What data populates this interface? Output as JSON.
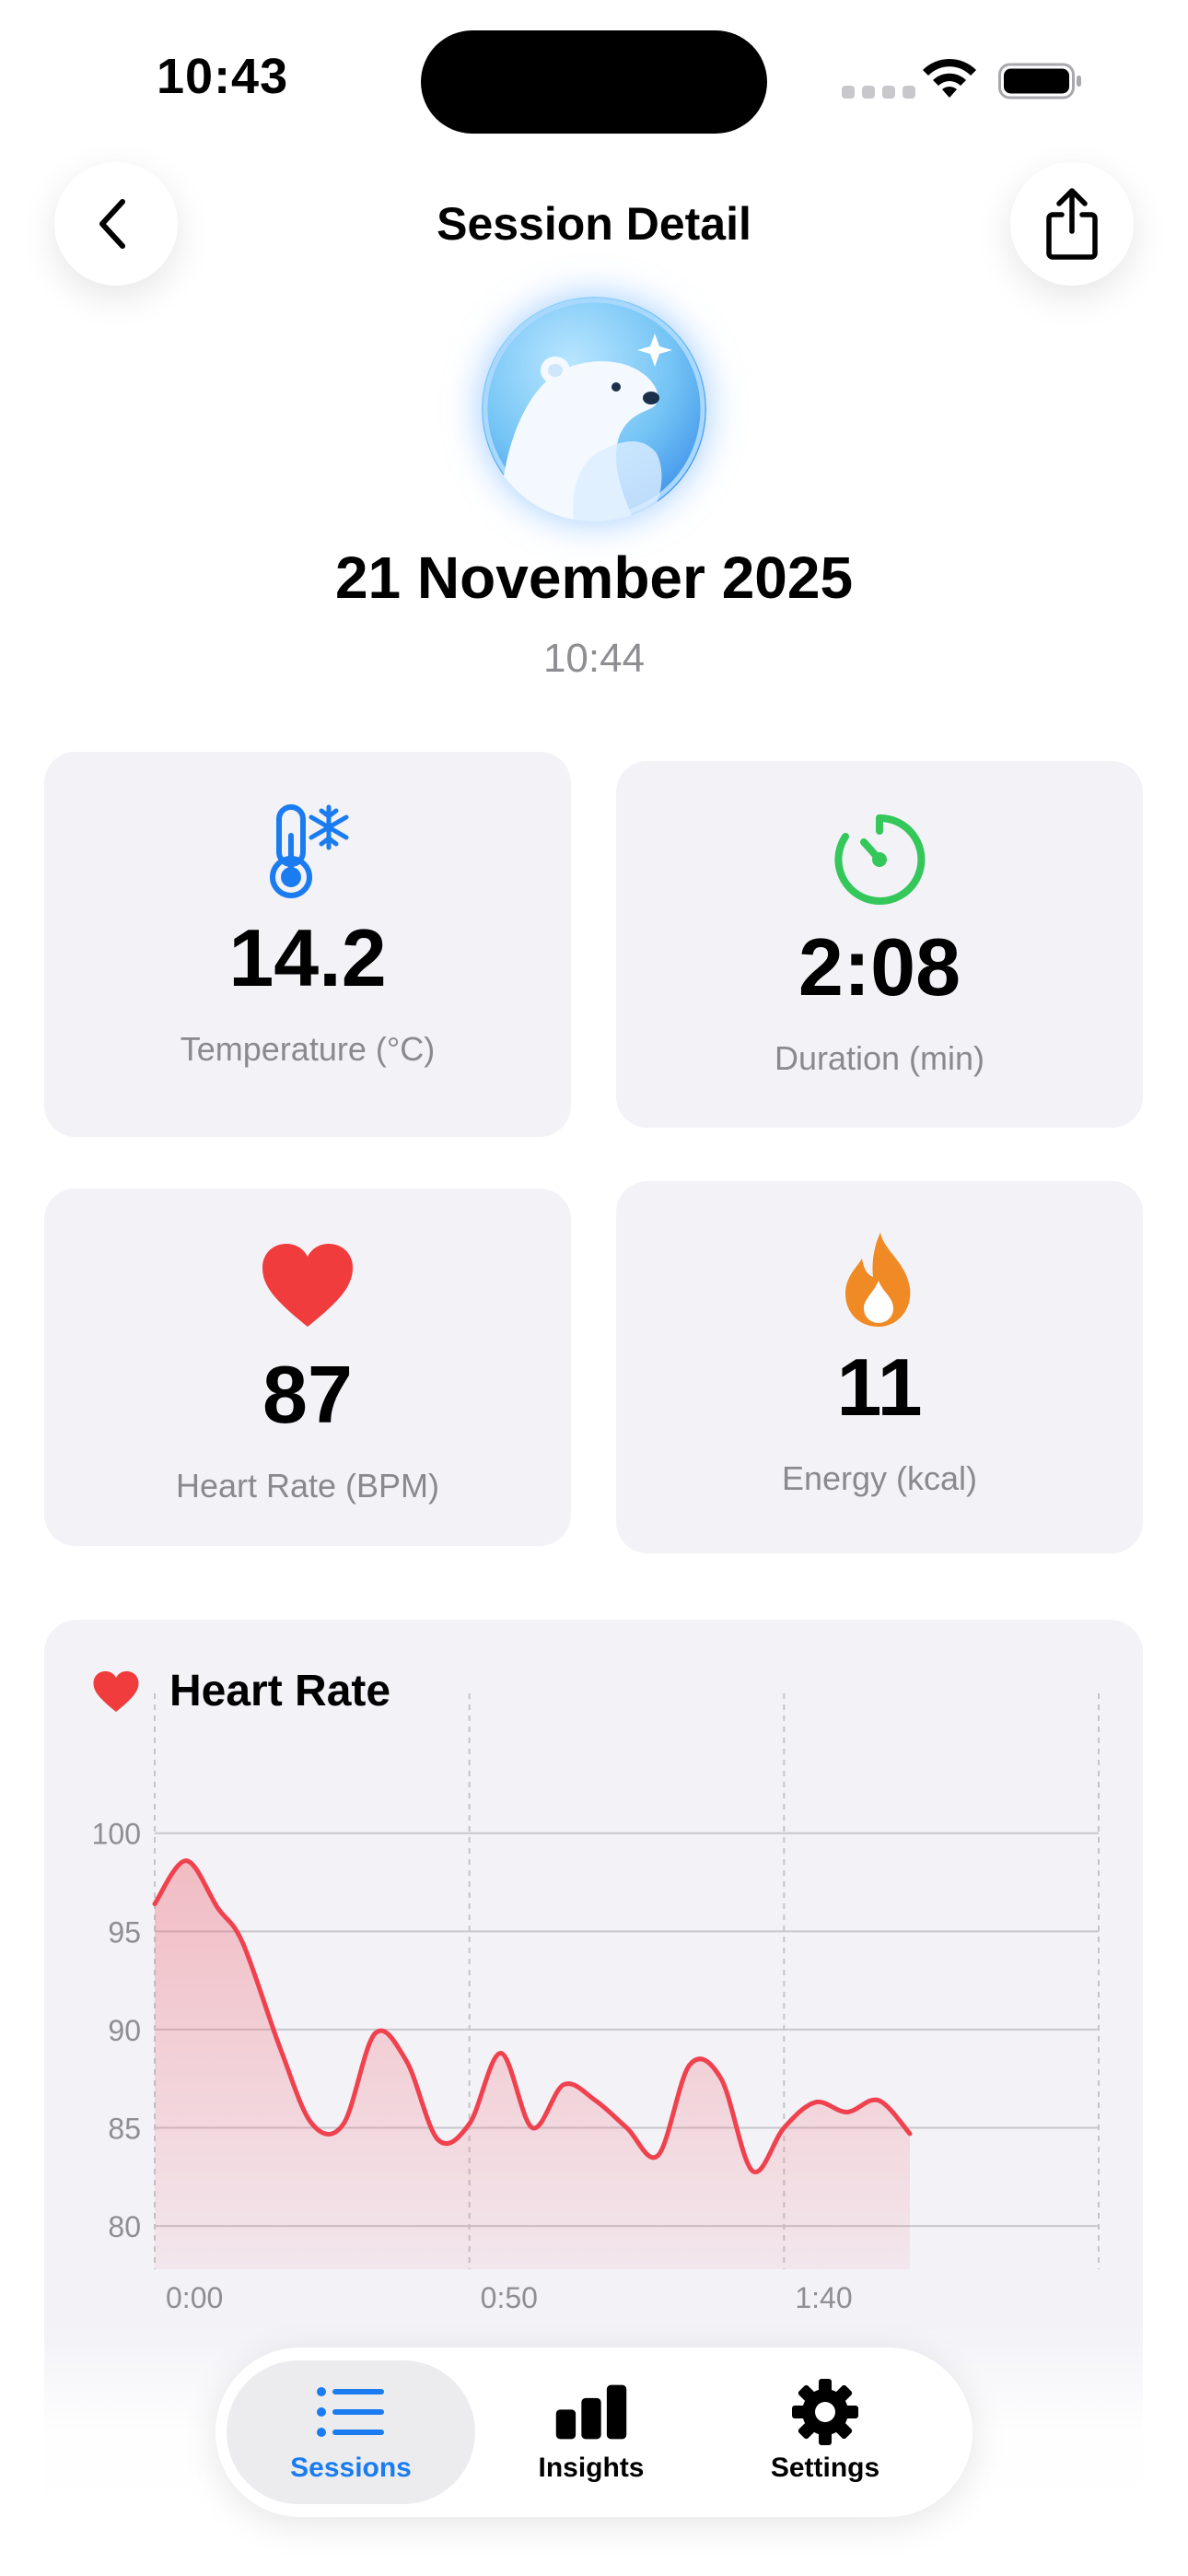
{
  "status_bar": {
    "time": "10:43"
  },
  "nav": {
    "title": "Session Detail"
  },
  "session": {
    "date": "21 November 2025",
    "time": "10:44"
  },
  "stats": {
    "temperature": {
      "value": "14.2",
      "label": "Temperature (°C)"
    },
    "duration": {
      "value": "2:08",
      "label": "Duration (min)"
    },
    "heart_rate": {
      "value": "87",
      "label": "Heart Rate (BPM)"
    },
    "energy": {
      "value": "11",
      "label": "Energy (kcal)"
    }
  },
  "chart_title": "Heart Rate",
  "colors": {
    "accent": "#1a7cf0",
    "heart": "#f03c3c",
    "timer": "#34c759",
    "energy": "#f08a24",
    "thermo": "#1a7cf0"
  },
  "chart_data": {
    "type": "area",
    "title": "Heart Rate",
    "xlabel": "",
    "ylabel": "",
    "x_ticks": [
      "0:00",
      "0:50",
      "1:40"
    ],
    "y_ticks": [
      80,
      85,
      90,
      95,
      100
    ],
    "xlim": [
      0,
      150
    ],
    "ylim": [
      77.8,
      103.6
    ],
    "grid": true,
    "series": [
      {
        "x": [
          0,
          5,
          10,
          14,
          20,
          25,
          30,
          35,
          40,
          45,
          50,
          55,
          60,
          65,
          70,
          75,
          80,
          85,
          90,
          95,
          100,
          105,
          110,
          115,
          120
        ],
        "y": [
          96.4,
          98.6,
          96.2,
          94.4,
          89.0,
          85.2,
          85.2,
          89.8,
          88.4,
          84.4,
          85.2,
          88.8,
          85.0,
          87.2,
          86.4,
          85.0,
          83.6,
          88.2,
          87.5,
          82.8,
          85.0,
          86.3,
          85.8,
          86.4,
          84.7
        ]
      }
    ]
  },
  "tabs": [
    {
      "label": "Sessions",
      "icon": "list-icon",
      "active": true
    },
    {
      "label": "Insights",
      "icon": "bar-chart-icon",
      "active": false
    },
    {
      "label": "Settings",
      "icon": "gear-icon",
      "active": false
    }
  ]
}
